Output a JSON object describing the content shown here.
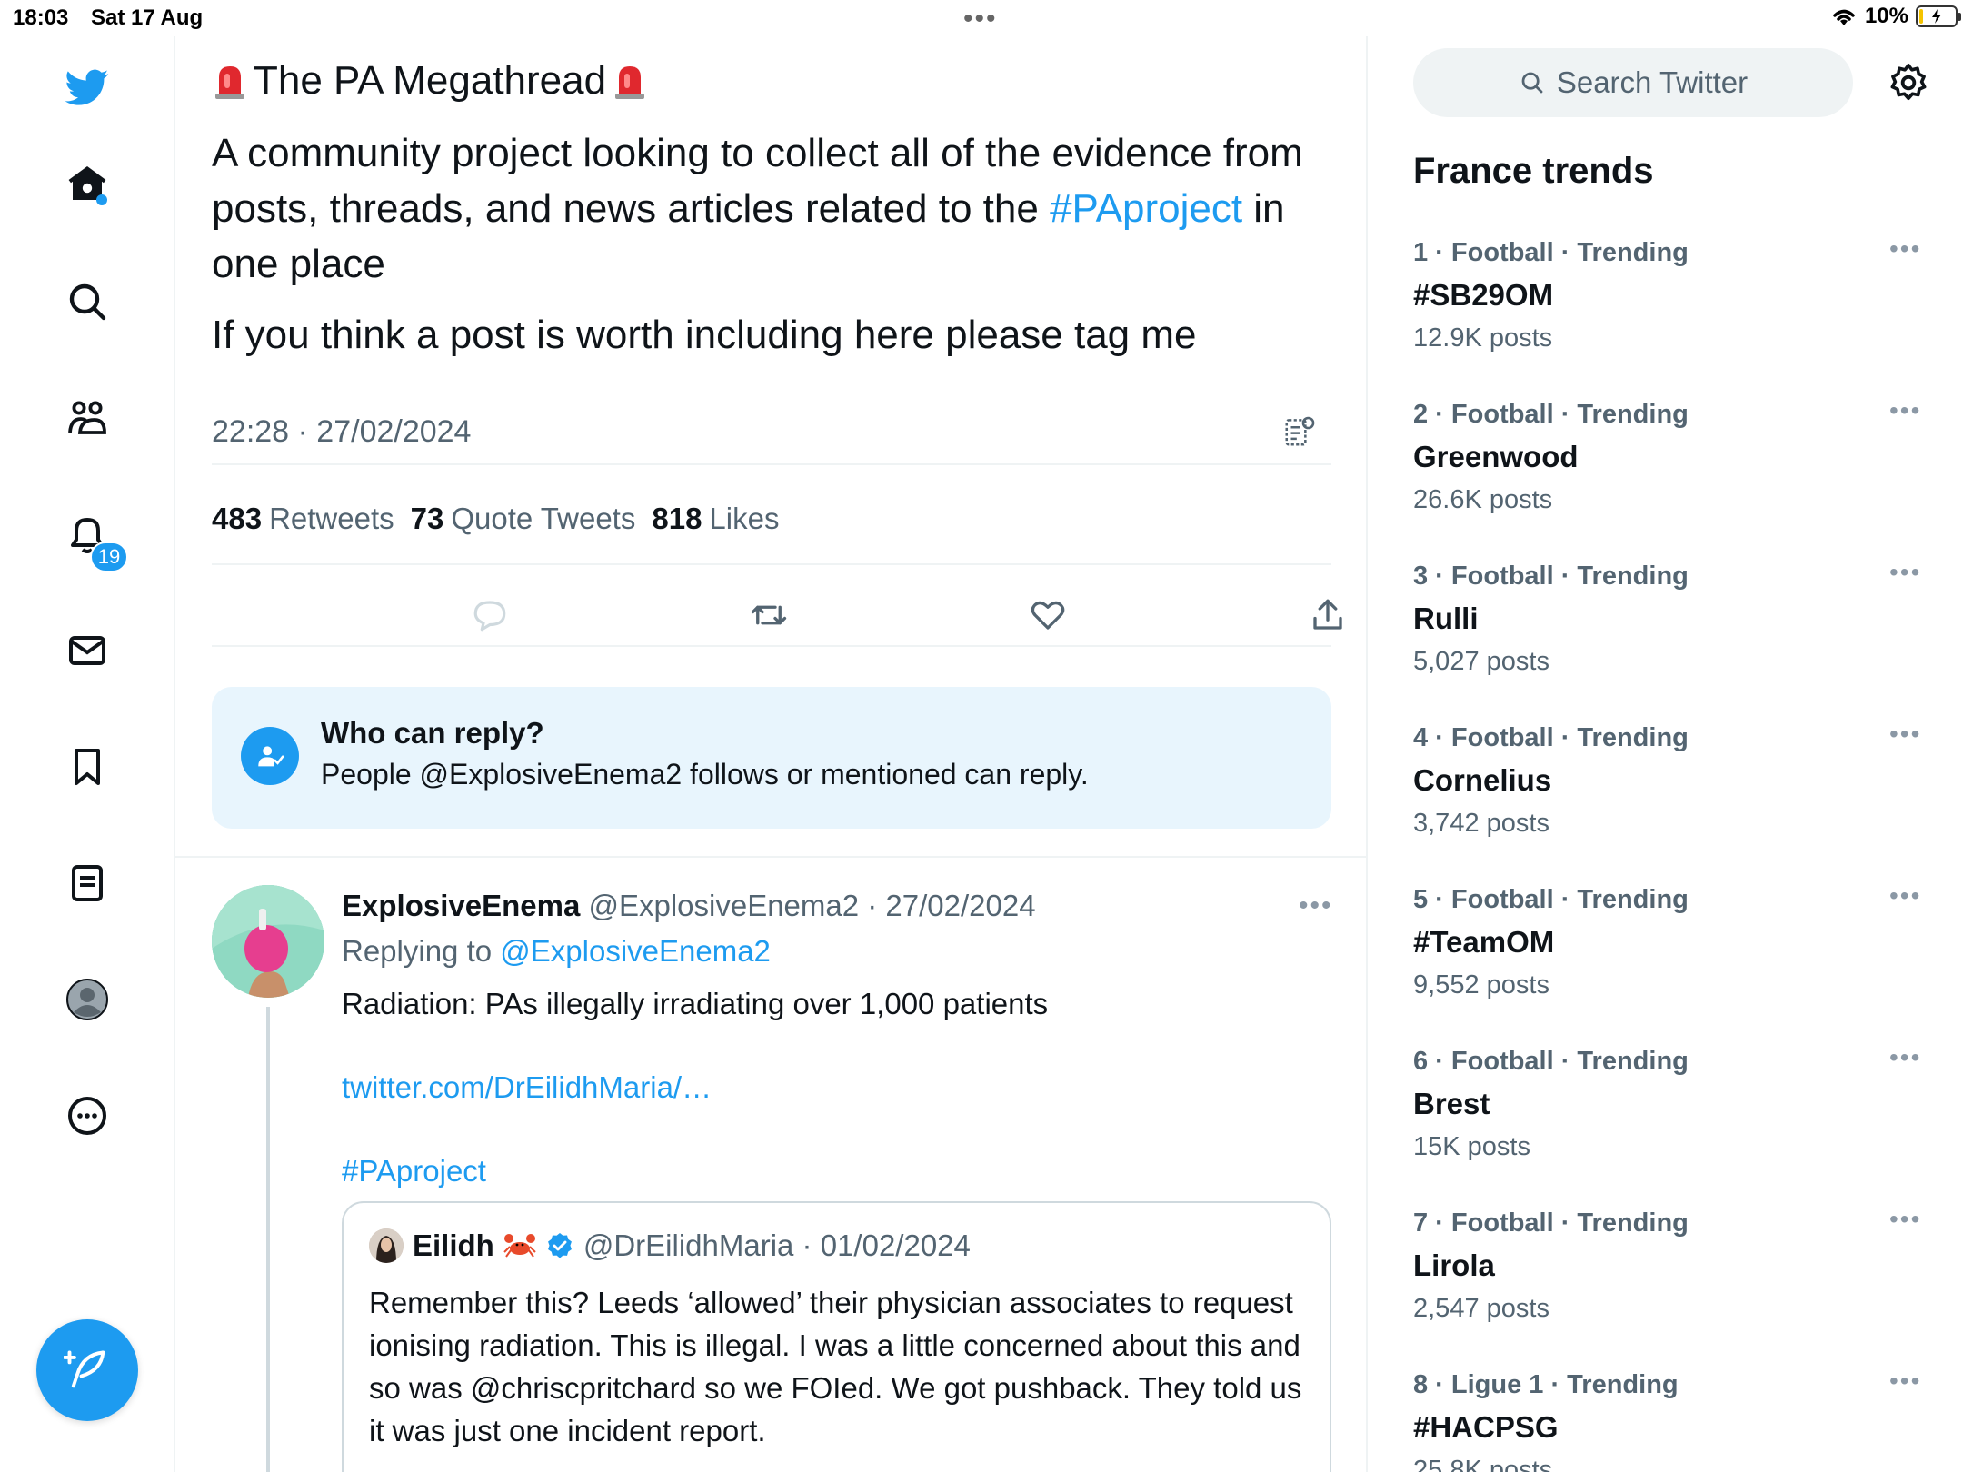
{
  "status_bar": {
    "time": "18:03",
    "date": "Sat 17 Aug",
    "battery": "10%",
    "battery_level": 0.1
  },
  "nav": {
    "notifications_badge": "19",
    "accent_color": "#1d9bf0"
  },
  "tweet": {
    "title": "The PA Megathread",
    "body_line1_pre": "A community project looking to collect all of the evidence from posts, threads, and news articles related to the ",
    "body_hashtag": "#PAproject",
    "body_line1_post": " in one place",
    "body_line2": "If you think a post is worth including here please tag me",
    "timestamp": "22:28 · 27/02/2024",
    "retweets_count": "483",
    "retweets_label": "Retweets",
    "quotes_count": "73",
    "quotes_label": "Quote Tweets",
    "likes_count": "818",
    "likes_label": "Likes"
  },
  "who_can_reply": {
    "title": "Who can reply?",
    "subtitle": "People @ExplosiveEnema2 follows or mentioned can reply."
  },
  "reply": {
    "name": "ExplosiveEnema",
    "handle_date": " @ExplosiveEnema2 · 27/02/2024",
    "replying_prefix": "Replying to ",
    "replying_handle": "@ExplosiveEnema2",
    "text": "Radiation: PAs illegally irradiating over 1,000 patients",
    "link": "twitter.com/DrEilidhMaria/…",
    "hashtag": "#PAproject"
  },
  "quote": {
    "name": "Eilidh",
    "handle_date": "@DrEilidhMaria · 01/02/2024",
    "text": "Remember this? Leeds ‘allowed’ their physician associates to request ionising radiation. This is illegal. I was a little concerned about this and so was @chriscpritchard so we FOIed. We got pushback. They told us it was just one incident report."
  },
  "sidebar": {
    "search_placeholder": "Search Twitter",
    "trends_title": "France trends",
    "trends": [
      {
        "meta": "1 · Football · Trending",
        "name": "#SB29OM",
        "posts": "12.9K posts"
      },
      {
        "meta": "2 · Football · Trending",
        "name": "Greenwood",
        "posts": "26.6K posts"
      },
      {
        "meta": "3 · Football · Trending",
        "name": "Rulli",
        "posts": "5,027 posts"
      },
      {
        "meta": "4 · Football · Trending",
        "name": "Cornelius",
        "posts": "3,742 posts"
      },
      {
        "meta": "5 · Football · Trending",
        "name": "#TeamOM",
        "posts": "9,552 posts"
      },
      {
        "meta": "6 · Football · Trending",
        "name": "Brest",
        "posts": "15K posts"
      },
      {
        "meta": "7 · Football · Trending",
        "name": "Lirola",
        "posts": "2,547 posts"
      },
      {
        "meta": "8 · Ligue 1 · Trending",
        "name": "#HACPSG",
        "posts": "25.8K posts"
      }
    ]
  }
}
